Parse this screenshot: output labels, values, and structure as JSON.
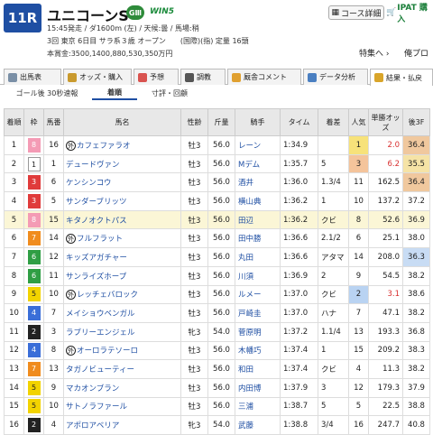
{
  "race": {
    "number": "11R",
    "name": "ユニコーンS",
    "grade": "GⅢ",
    "win5": "WIN5",
    "line1": "15:45発走 / ダ1600m (左) / 天候:曇 / 馬場:稍",
    "line2": "3回 東京 6日目 サラ系３歳 オープン　　(国際)(指) 定量 16頭",
    "line3": "本賞金:3500,1400,880,530,350万円",
    "course_btn": "コース詳細",
    "ipat": "IPAT 購入",
    "special": "特集へ",
    "oresen": "俺プロ"
  },
  "tabs": [
    "出馬表",
    "オッズ・購入",
    "予想",
    "調教",
    "厩舎コメント",
    "データ分析",
    "結果・払戻"
  ],
  "subtabs": [
    "ゴール後 30秒速報",
    "着順",
    "寸評・回顧"
  ],
  "headers": [
    "着順",
    "枠",
    "馬番",
    "馬名",
    "性齢",
    "斤量",
    "騎手",
    "タイム",
    "着差",
    "人気",
    "単勝オッズ",
    "後3F"
  ],
  "rows": [
    {
      "pos": "1",
      "waku": "8",
      "umaban": "16",
      "name": "カフェファラオ",
      "mark": "外",
      "sex": "牡3",
      "kin": "56.0",
      "jockey": "レーン",
      "time": "1:34.9",
      "diff": "",
      "pop": "1",
      "odds": "2.0",
      "f3": "36.4"
    },
    {
      "pos": "2",
      "waku": "1",
      "umaban": "1",
      "name": "デュードヴァン",
      "mark": "",
      "sex": "牡3",
      "kin": "56.0",
      "jockey": "Mデム",
      "time": "1:35.7",
      "diff": "5",
      "pop": "3",
      "odds": "6.2",
      "f3": "35.5"
    },
    {
      "pos": "3",
      "waku": "3",
      "umaban": "6",
      "name": "ケンシンコウ",
      "mark": "",
      "sex": "牡3",
      "kin": "56.0",
      "jockey": "酒井",
      "time": "1:36.0",
      "diff": "1.3/4",
      "pop": "11",
      "odds": "162.5",
      "f3": "36.4"
    },
    {
      "pos": "4",
      "waku": "3",
      "umaban": "5",
      "name": "サンダーブリッツ",
      "mark": "",
      "sex": "牡3",
      "kin": "56.0",
      "jockey": "横山典",
      "time": "1:36.2",
      "diff": "1",
      "pop": "10",
      "odds": "137.2",
      "f3": "37.2"
    },
    {
      "pos": "5",
      "waku": "8",
      "umaban": "15",
      "name": "キタノオクトパス",
      "mark": "",
      "sex": "牡3",
      "kin": "56.0",
      "jockey": "田辺",
      "time": "1:36.2",
      "diff": "クビ",
      "pop": "8",
      "odds": "52.6",
      "f3": "36.9"
    },
    {
      "pos": "6",
      "waku": "7",
      "umaban": "14",
      "name": "フルフラット",
      "mark": "外",
      "sex": "牡3",
      "kin": "56.0",
      "jockey": "田中勝",
      "time": "1:36.6",
      "diff": "2.1/2",
      "pop": "6",
      "odds": "25.1",
      "f3": "38.0"
    },
    {
      "pos": "7",
      "waku": "6",
      "umaban": "12",
      "name": "キッズアガチャー",
      "mark": "",
      "sex": "牡3",
      "kin": "56.0",
      "jockey": "丸田",
      "time": "1:36.6",
      "diff": "アタマ",
      "pop": "14",
      "odds": "208.0",
      "f3": "36.3"
    },
    {
      "pos": "8",
      "waku": "6",
      "umaban": "11",
      "name": "サンライズホープ",
      "mark": "",
      "sex": "牡3",
      "kin": "56.0",
      "jockey": "川須",
      "time": "1:36.9",
      "diff": "2",
      "pop": "9",
      "odds": "54.5",
      "f3": "38.2"
    },
    {
      "pos": "9",
      "waku": "5",
      "umaban": "10",
      "name": "レッチェバロック",
      "mark": "外",
      "sex": "牡3",
      "kin": "56.0",
      "jockey": "ルメー",
      "time": "1:37.0",
      "diff": "クビ",
      "pop": "2",
      "odds": "3.1",
      "f3": "38.6"
    },
    {
      "pos": "10",
      "waku": "4",
      "umaban": "7",
      "name": "メイショウベンガル",
      "mark": "",
      "sex": "牡3",
      "kin": "56.0",
      "jockey": "戸崎圭",
      "time": "1:37.0",
      "diff": "ハナ",
      "pop": "7",
      "odds": "47.1",
      "f3": "38.2"
    },
    {
      "pos": "11",
      "waku": "2",
      "umaban": "3",
      "name": "ラブリーエンジェル",
      "mark": "",
      "sex": "牝3",
      "kin": "54.0",
      "jockey": "菅原明",
      "time": "1:37.2",
      "diff": "1.1/4",
      "pop": "13",
      "odds": "193.3",
      "f3": "36.8"
    },
    {
      "pos": "12",
      "waku": "4",
      "umaban": "8",
      "name": "オーロラテソーロ",
      "mark": "外",
      "sex": "牡3",
      "kin": "56.0",
      "jockey": "木幡巧",
      "time": "1:37.4",
      "diff": "1",
      "pop": "15",
      "odds": "209.2",
      "f3": "38.3"
    },
    {
      "pos": "13",
      "waku": "7",
      "umaban": "13",
      "name": "タガノビューティー",
      "mark": "",
      "sex": "牡3",
      "kin": "56.0",
      "jockey": "和田",
      "time": "1:37.4",
      "diff": "クビ",
      "pop": "4",
      "odds": "11.3",
      "f3": "38.2"
    },
    {
      "pos": "14",
      "waku": "5",
      "umaban": "9",
      "name": "マカオンブラン",
      "mark": "",
      "sex": "牡3",
      "kin": "56.0",
      "jockey": "内田博",
      "time": "1:37.9",
      "diff": "3",
      "pop": "12",
      "odds": "179.3",
      "f3": "37.9"
    },
    {
      "pos": "15",
      "waku": "5",
      "umaban": "10",
      "name": "サトノラファール",
      "mark": "",
      "sex": "牡3",
      "kin": "56.0",
      "jockey": "三浦",
      "time": "1:38.7",
      "diff": "5",
      "pop": "5",
      "odds": "22.5",
      "f3": "38.8"
    },
    {
      "pos": "16",
      "waku": "2",
      "umaban": "4",
      "name": "アポロアベリア",
      "mark": "",
      "sex": "牝3",
      "kin": "54.0",
      "jockey": "武藤",
      "time": "1:38.8",
      "diff": "3/4",
      "pop": "16",
      "odds": "247.7",
      "f3": "40.8"
    }
  ],
  "colors": {
    "waku": {
      "1": [
        "#ffffff",
        "#222"
      ],
      "2": [
        "#222222",
        "#fff"
      ],
      "3": [
        "#e03b3b",
        "#fff"
      ],
      "4": [
        "#3a6ed8",
        "#fff"
      ],
      "5": [
        "#f2d300",
        "#222"
      ],
      "6": [
        "#2f9e44",
        "#fff"
      ],
      "7": [
        "#f08c1e",
        "#fff"
      ],
      "8": [
        "#f49bb5",
        "#fff"
      ]
    },
    "pop1": "#f7e27a",
    "pop2": "#b9d3f2",
    "pop3": "#f4c49b",
    "f3hl": "#f0c89e",
    "f3hl2": "#f5e3a6",
    "f3hl3": "#c8dcf4"
  }
}
